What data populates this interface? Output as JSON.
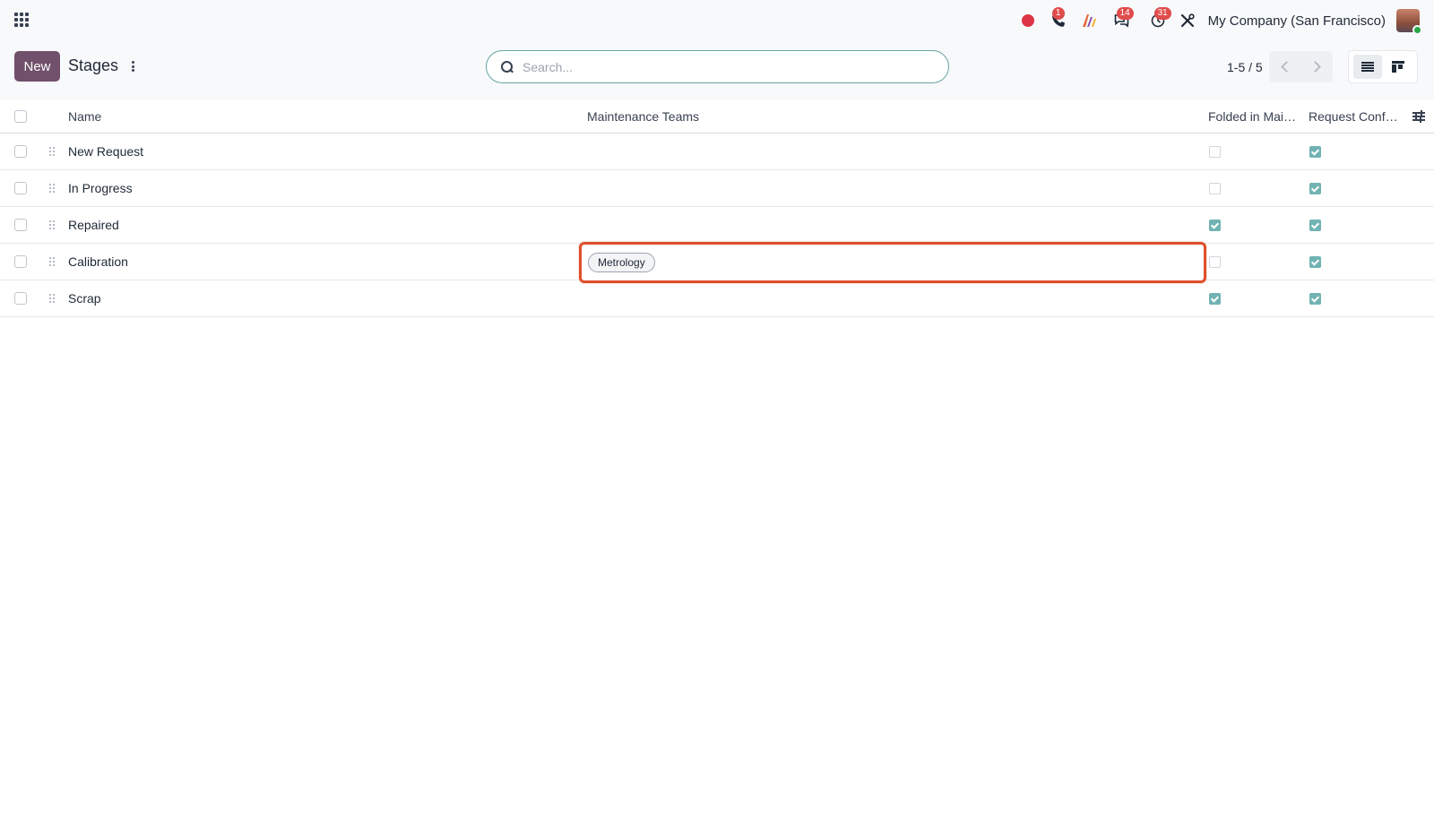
{
  "navbar": {
    "apps_icon": "apps-grid-icon",
    "badges": {
      "phone": "1",
      "messages": "14",
      "activities": "31"
    },
    "company": "My Company (San Francisco)"
  },
  "control_panel": {
    "new_label": "New",
    "title": "Stages",
    "search_placeholder": "Search...",
    "pager": "1-5 / 5"
  },
  "table": {
    "headers": {
      "name": "Name",
      "teams": "Maintenance Teams",
      "folded": "Folded in Mai…",
      "request_confirmed": "Request Conf…"
    },
    "rows": [
      {
        "name": "New Request",
        "folded": false,
        "request_confirmed": true
      },
      {
        "name": "In Progress",
        "folded": false,
        "request_confirmed": true
      },
      {
        "name": "Repaired",
        "folded": true,
        "request_confirmed": true
      },
      {
        "name": "Calibration",
        "folded": false,
        "request_confirmed": true
      },
      {
        "name": "Scrap",
        "folded": true,
        "request_confirmed": true
      }
    ],
    "editing": {
      "row_index": 3,
      "tag": "Metrology"
    }
  },
  "colors": {
    "primary": "#71506b",
    "checkbox_checked": "#71b3b3",
    "highlight_border": "#e04f2a",
    "badge": "#e04b4b"
  }
}
